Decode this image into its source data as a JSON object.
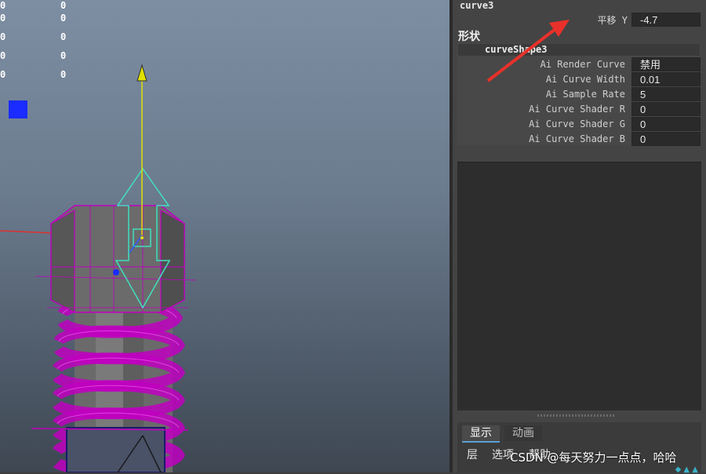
{
  "hud": {
    "rows": [
      {
        "a": "0",
        "b": "0"
      },
      {
        "a": "0",
        "b": "0"
      },
      {
        "a": "0",
        "b": "0"
      },
      {
        "a": "0",
        "b": "0"
      },
      {
        "a": "0",
        "b": "0"
      }
    ]
  },
  "viewport": {
    "colors": {
      "wire": "#c000c0",
      "manip": "#40e0c0",
      "axis_y": "#e0e000",
      "axis_x": "#e03030",
      "marker": "#1a2cff"
    }
  },
  "attribute_editor": {
    "node_name": "curve3",
    "translate_y": {
      "label": "平移 Y",
      "value": "-4.7"
    },
    "shape_section": {
      "title": "形状",
      "shape_name": "curveShape3",
      "attributes": [
        {
          "label": "Ai Render Curve",
          "value": "禁用"
        },
        {
          "label": "Ai Curve Width",
          "value": "0.01"
        },
        {
          "label": "Ai Sample Rate",
          "value": "5"
        },
        {
          "label": "Ai Curve Shader R",
          "value": "0"
        },
        {
          "label": "Ai Curve Shader G",
          "value": "0"
        },
        {
          "label": "Ai Curve Shader B",
          "value": "0"
        }
      ]
    }
  },
  "bottom_panel": {
    "tabs": [
      "显示",
      "动画"
    ],
    "menu": [
      "层",
      "选项",
      "帮助"
    ]
  },
  "watermark": "CSDN @每天努力一点点，哈哈",
  "annotation": {
    "arrow_color": "#e8312a"
  }
}
